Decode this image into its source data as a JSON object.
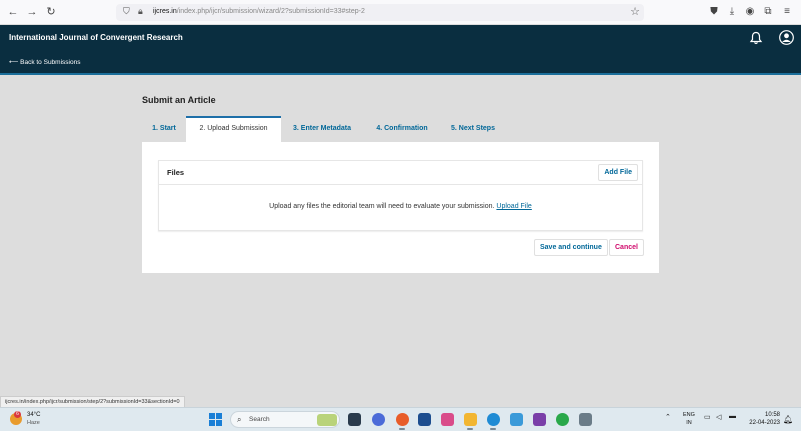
{
  "browser": {
    "url_host": "ijcres.in",
    "url_path": "/index.php/ijcr/submission/wizard/2?submissionId=33#step-2",
    "status_url": "ijcres.in/index.php/ijcr/submission/step/2?submissionId=33&sectionId=0"
  },
  "header": {
    "journal_title": "International Journal of Convergent Research",
    "back_link": "⟵ Back to Submissions"
  },
  "page": {
    "title": "Submit an Article",
    "tabs": [
      {
        "label": "1. Start"
      },
      {
        "label": "2. Upload Submission"
      },
      {
        "label": "3. Enter Metadata"
      },
      {
        "label": "4. Confirmation"
      },
      {
        "label": "5. Next Steps"
      }
    ],
    "active_tab": 1,
    "files": {
      "title": "Files",
      "add_button": "Add File",
      "message": "Upload any files the editorial team will need to evaluate your submission.",
      "upload_link": "Upload File"
    },
    "save_button": "Save and continue",
    "cancel_button": "Cancel"
  },
  "taskbar": {
    "weather_temp": "34°C",
    "weather_cond": "Haze",
    "weather_badge": "6",
    "search_label": "Search",
    "lang_top": "ENG",
    "lang_bottom": "IN",
    "time": "10:58",
    "date": "22-04-2023"
  },
  "colors": {
    "header_bg": "#0a2e40",
    "link": "#006798",
    "cancel": "#d00a6c",
    "page_bg": "#dddddd"
  }
}
